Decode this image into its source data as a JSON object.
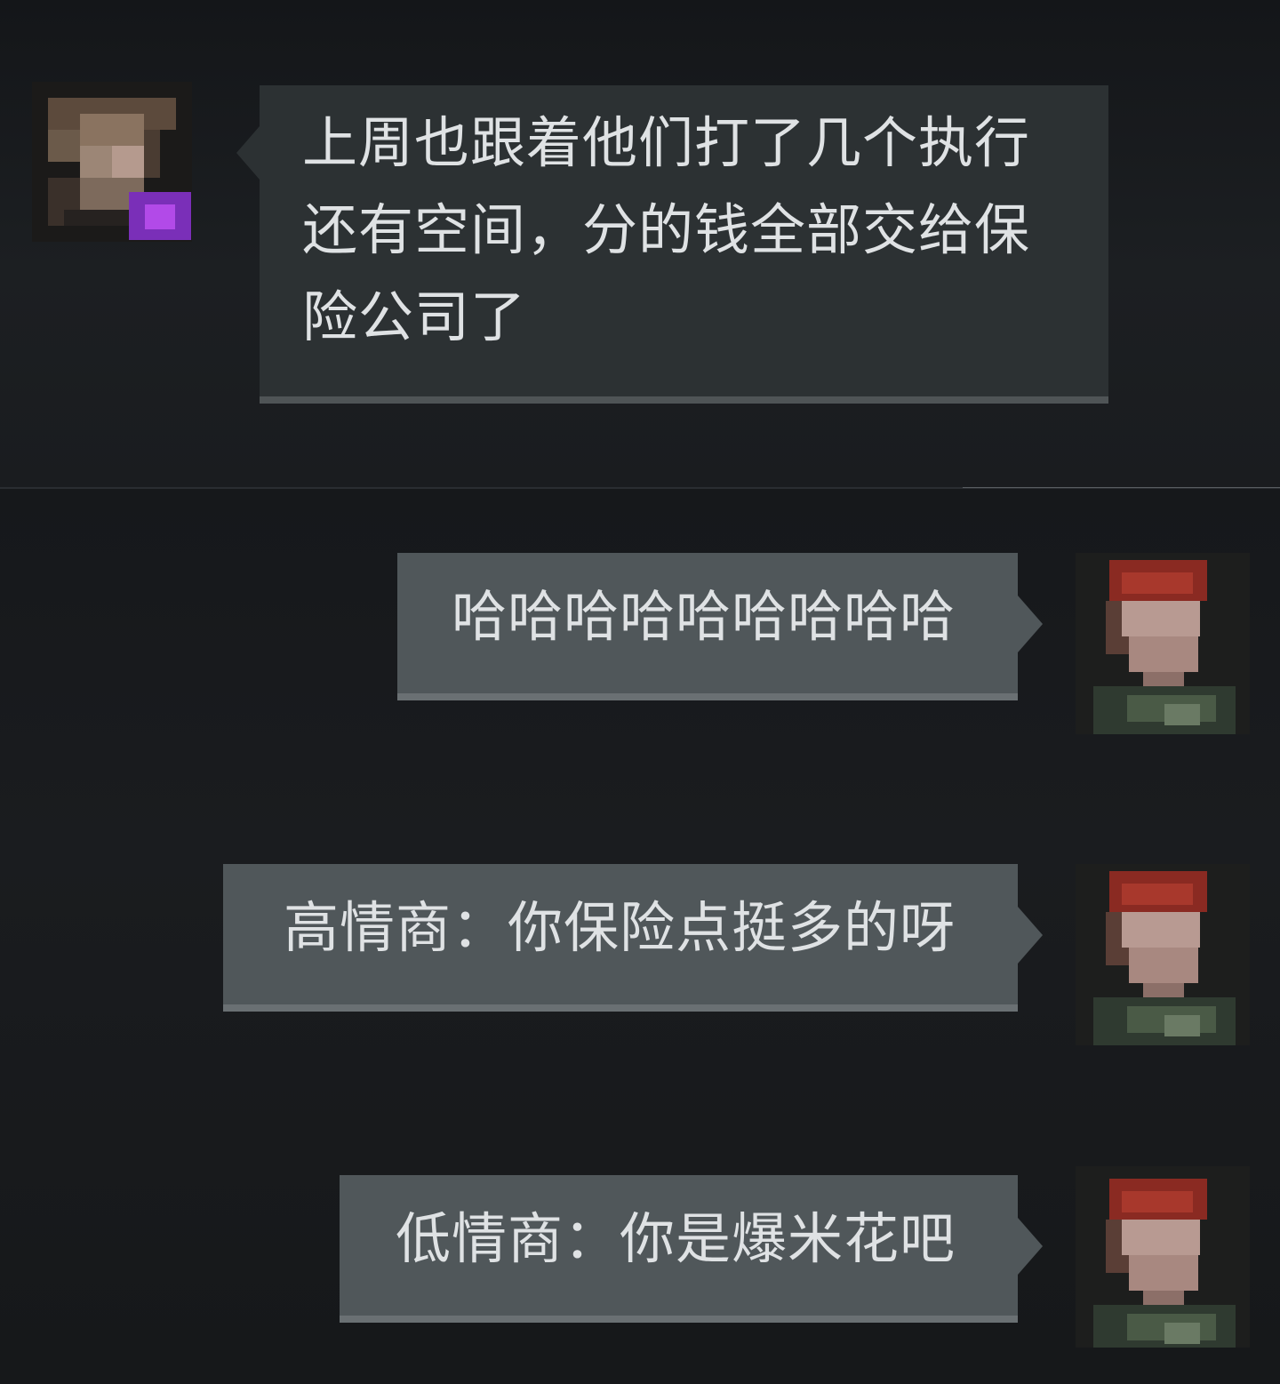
{
  "messages": [
    {
      "side": "left",
      "avatar": "avatar-blurred",
      "text": "上周也跟着他们打了几个执行还有空间，分的钱全部交给保险公司了"
    },
    {
      "side": "right",
      "avatar": "avatar-blurred",
      "text": "哈哈哈哈哈哈哈哈哈"
    },
    {
      "side": "right",
      "avatar": "avatar-blurred",
      "text": "高情商：你保险点挺多的呀"
    },
    {
      "side": "right",
      "avatar": "avatar-blurred",
      "text": "低情商：你是爆米花吧"
    }
  ],
  "colors": {
    "background": "#17191c",
    "left_bubble": "#2c3133",
    "right_bubble": "#50575a",
    "text": "#dfe2e4",
    "badge": "#b24ae8"
  }
}
